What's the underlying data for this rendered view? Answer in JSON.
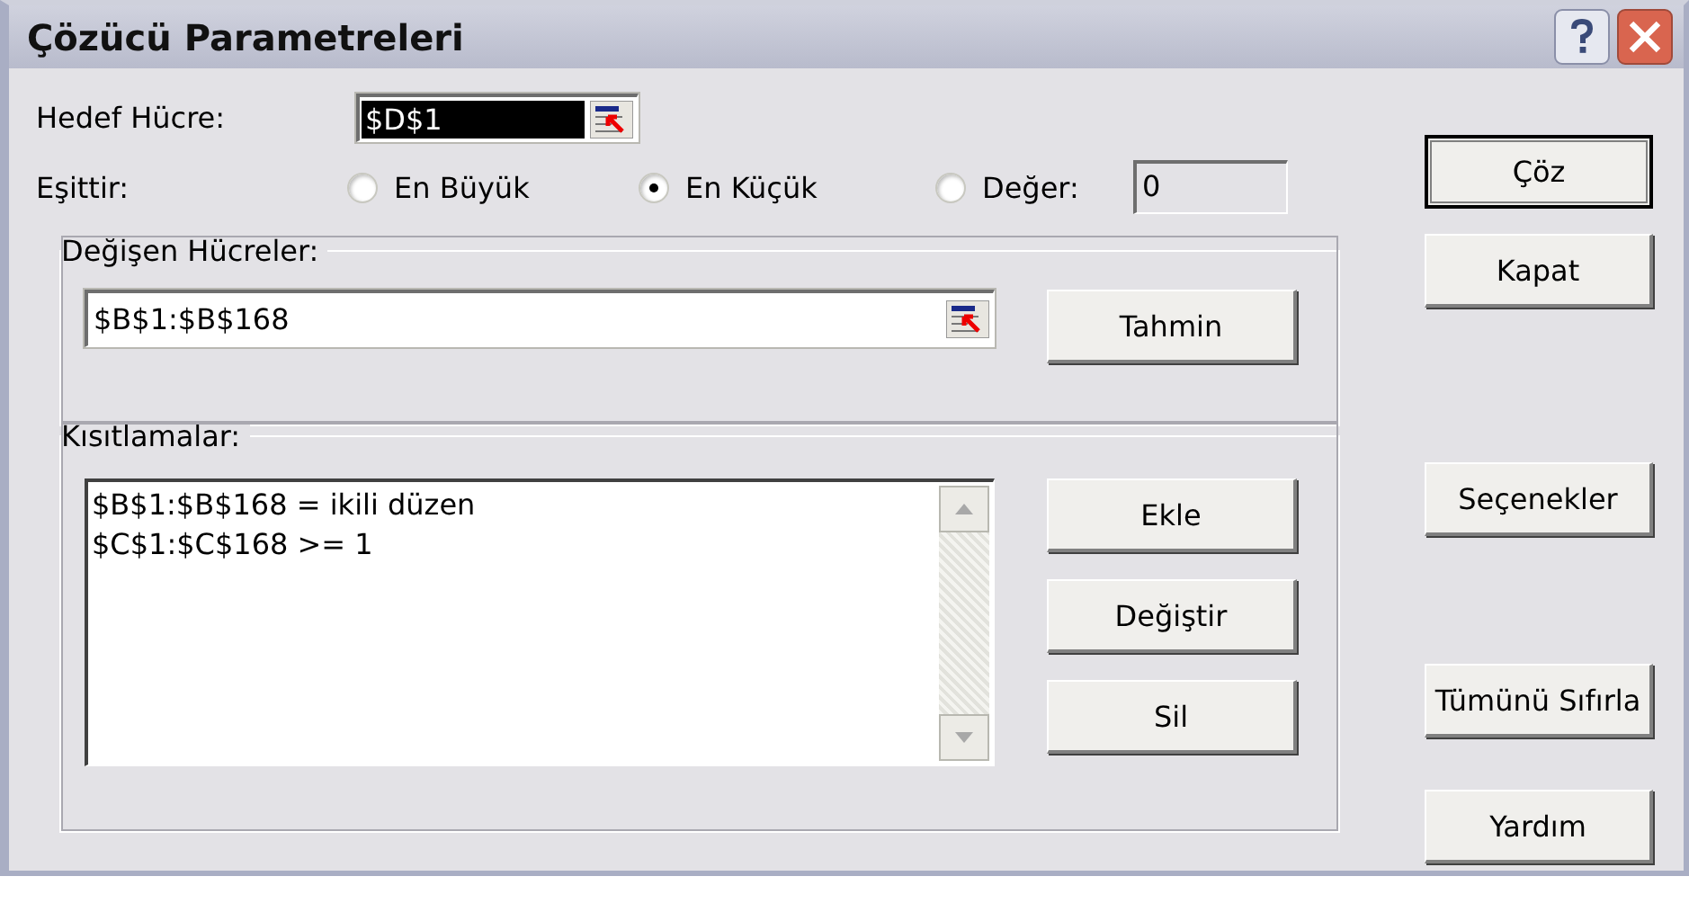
{
  "window": {
    "title": "Çözücü Parametreleri"
  },
  "target_cell": {
    "label": "Hedef Hücre:",
    "value": "$D$1",
    "selected": true
  },
  "equal_to": {
    "label": "Eşittir:",
    "options": [
      {
        "label": "En Büyük",
        "selected": false
      },
      {
        "label": "En Küçük",
        "selected": true
      },
      {
        "label": "Değer:",
        "selected": false
      }
    ],
    "value": "0"
  },
  "changing_cells": {
    "title": "Değişen Hücreler:",
    "value": "$B$1:$B$168",
    "button": "Tahmin"
  },
  "constraints": {
    "title": "Kısıtlamalar:",
    "items": [
      "$B$1:$B$168 = ikili düzen",
      "$C$1:$C$168 >= 1"
    ],
    "buttons": [
      "Ekle",
      "Değiştir",
      "Sil"
    ]
  },
  "side_buttons": [
    {
      "label": "Çöz",
      "default": true
    },
    {
      "label": "Kapat",
      "default": false
    },
    {
      "label": "Seçenekler",
      "default": false
    },
    {
      "label": "Tümünü Sıfırla",
      "default": false
    },
    {
      "label": "Yardım",
      "default": false
    }
  ]
}
